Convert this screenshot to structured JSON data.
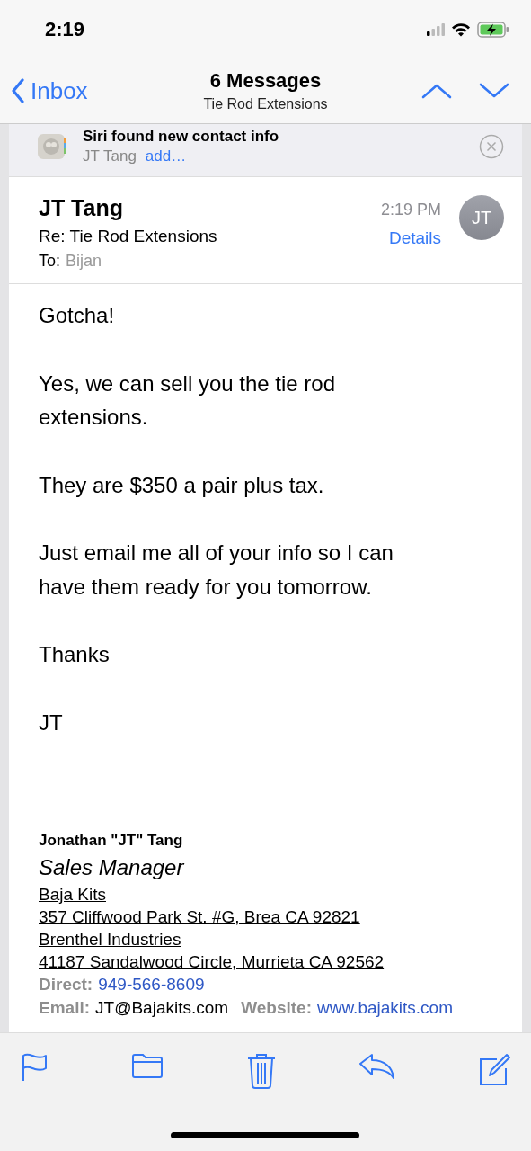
{
  "status_bar": {
    "time": "2:19"
  },
  "nav": {
    "back_label": "Inbox",
    "title": "6 Messages",
    "subtitle": "Tie Rod Extensions"
  },
  "siri_banner": {
    "title": "Siri found new contact info",
    "contact": "JT Tang",
    "action": "add…"
  },
  "message": {
    "sender": "JT Tang",
    "subject": "Re: Tie Rod Extensions",
    "to_label": "To:",
    "recipient": "Bijan",
    "time": "2:19 PM",
    "details": "Details",
    "avatar": "JT"
  },
  "body": [
    "Gotcha!",
    "Yes, we can sell you the tie rod extensions.",
    "They are $350 a pair plus tax.",
    "Just email me all of your info so I can have them ready for you tomorrow.",
    "Thanks",
    "JT"
  ],
  "signature": {
    "name": "Jonathan \"JT\" Tang",
    "title": "Sales Manager",
    "address_lines": [
      "Baja Kits",
      "357 Cliffwood Park St. #G, Brea CA 92821",
      "Brenthel Industries",
      "41187 Sandalwood Circle, Murrieta CA 92562"
    ],
    "contact_lines": [
      {
        "items": [
          {
            "label": "Direct:",
            "value": "949-566-8609",
            "kind": "link"
          }
        ]
      },
      {
        "items": [
          {
            "label": "Email:",
            "value": "JT@Bajakits.com",
            "kind": "plain"
          },
          {
            "label": "Website:",
            "value": "www.bajakits.com",
            "kind": "link"
          }
        ]
      }
    ]
  }
}
